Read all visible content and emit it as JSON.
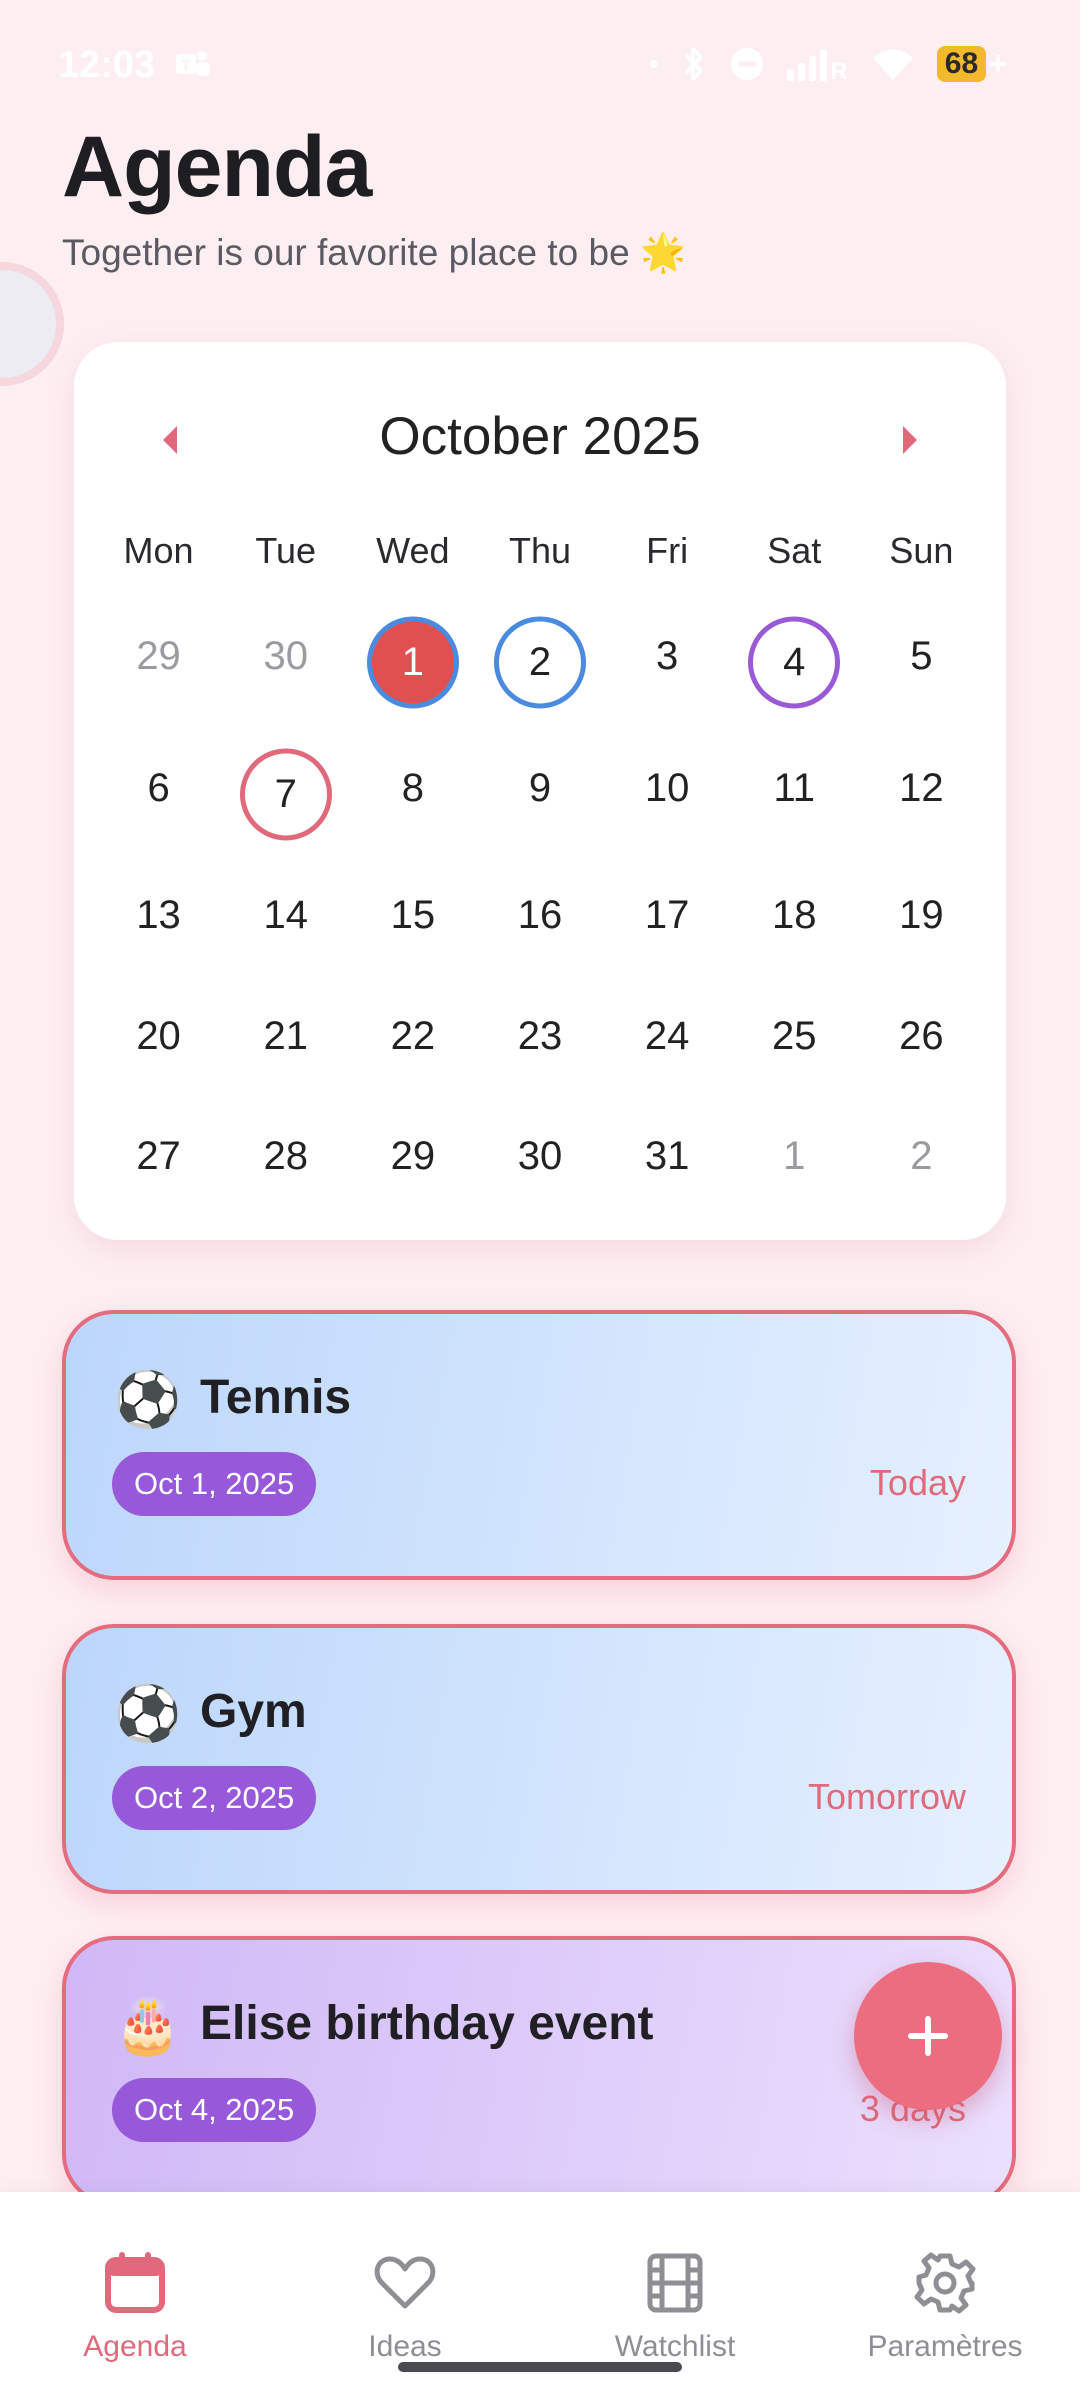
{
  "status_bar": {
    "time": "12:03",
    "battery": "68",
    "battery_plus": "+"
  },
  "header": {
    "title": "Agenda",
    "subtitle": "Together is our favorite place to be 🌟"
  },
  "calendar": {
    "month_label": "October 2025",
    "weekdays": [
      "Mon",
      "Tue",
      "Wed",
      "Thu",
      "Fri",
      "Sat",
      "Sun"
    ],
    "days": [
      {
        "n": "29",
        "muted": true
      },
      {
        "n": "30",
        "muted": true
      },
      {
        "n": "1",
        "mark": "selected"
      },
      {
        "n": "2",
        "mark": "blue"
      },
      {
        "n": "3"
      },
      {
        "n": "4",
        "mark": "purple"
      },
      {
        "n": "5"
      },
      {
        "n": "6"
      },
      {
        "n": "7",
        "mark": "pink"
      },
      {
        "n": "8"
      },
      {
        "n": "9"
      },
      {
        "n": "10"
      },
      {
        "n": "11"
      },
      {
        "n": "12"
      },
      {
        "n": "13"
      },
      {
        "n": "14"
      },
      {
        "n": "15"
      },
      {
        "n": "16"
      },
      {
        "n": "17"
      },
      {
        "n": "18"
      },
      {
        "n": "19"
      },
      {
        "n": "20"
      },
      {
        "n": "21"
      },
      {
        "n": "22"
      },
      {
        "n": "23"
      },
      {
        "n": "24"
      },
      {
        "n": "25"
      },
      {
        "n": "26"
      },
      {
        "n": "27"
      },
      {
        "n": "28"
      },
      {
        "n": "29"
      },
      {
        "n": "30"
      },
      {
        "n": "31"
      },
      {
        "n": "1",
        "muted": true
      },
      {
        "n": "2",
        "muted": true
      }
    ]
  },
  "events": [
    {
      "icon": "⚽",
      "icon_name": "soccer-ball-icon",
      "title": "Tennis",
      "date": "Oct 1, 2025",
      "relative": "Today",
      "theme": "blue"
    },
    {
      "icon": "⚽",
      "icon_name": "soccer-ball-icon",
      "title": "Gym",
      "date": "Oct 2, 2025",
      "relative": "Tomorrow",
      "theme": "blue"
    },
    {
      "icon": "🎂",
      "icon_name": "birthday-cake-icon",
      "title": "Elise birthday event",
      "date": "Oct 4, 2025",
      "relative": "3 days",
      "theme": "purple"
    }
  ],
  "fab": {
    "icon": "plus-icon"
  },
  "bottom_nav": {
    "items": [
      {
        "label": "Agenda",
        "icon": "calendar-icon",
        "active": true
      },
      {
        "label": "Ideas",
        "icon": "heart-icon",
        "active": false
      },
      {
        "label": "Watchlist",
        "icon": "film-icon",
        "active": false
      },
      {
        "label": "Paramètres",
        "icon": "gear-icon",
        "active": false
      }
    ]
  },
  "colors": {
    "background": "#fdeef1",
    "accent": "#e06a7c",
    "date_pill": "#9759d9",
    "selected_day": "#e05050",
    "ring_blue": "#4a8be0",
    "ring_purple": "#9a5ad6"
  }
}
